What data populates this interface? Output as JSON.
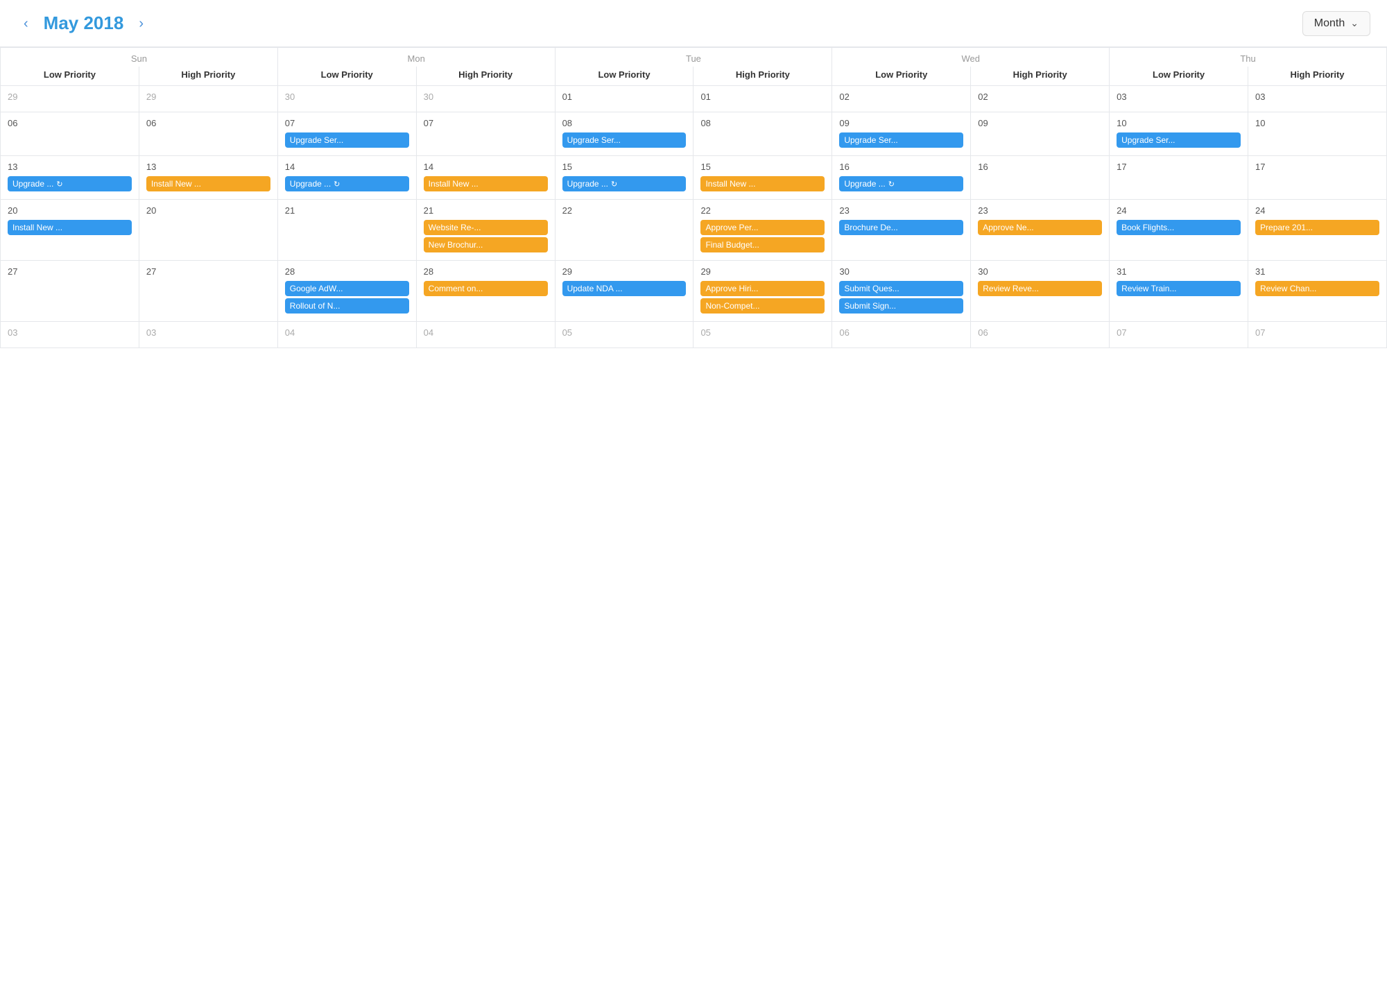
{
  "header": {
    "title": "May 2018",
    "prev_label": "‹",
    "next_label": "›",
    "view_label": "Month",
    "chevron": "⌄"
  },
  "days": [
    {
      "name": "Sun",
      "cols": [
        "Low Priority",
        "High Priority"
      ]
    },
    {
      "name": "Mon",
      "cols": [
        "Low Priority",
        "High Priority"
      ]
    },
    {
      "name": "Tue",
      "cols": [
        "Low Priority",
        "High Priority"
      ]
    },
    {
      "name": "Wed",
      "cols": [
        "Low Priority",
        "High Priority"
      ]
    },
    {
      "name": "Thu",
      "cols": [
        "Low Priority",
        "High Priority"
      ]
    }
  ],
  "weeks": [
    {
      "cells": [
        {
          "date": "29",
          "month": "prev",
          "events": []
        },
        {
          "date": "29",
          "month": "prev",
          "events": []
        },
        {
          "date": "30",
          "month": "prev",
          "events": []
        },
        {
          "date": "30",
          "month": "prev",
          "events": []
        },
        {
          "date": "01",
          "month": "curr",
          "events": []
        },
        {
          "date": "01",
          "month": "curr",
          "events": []
        },
        {
          "date": "02",
          "month": "curr",
          "events": []
        },
        {
          "date": "02",
          "month": "curr",
          "events": []
        },
        {
          "date": "03",
          "month": "curr",
          "events": []
        },
        {
          "date": "03",
          "month": "curr",
          "events": []
        }
      ]
    },
    {
      "cells": [
        {
          "date": "06",
          "month": "curr",
          "events": []
        },
        {
          "date": "06",
          "month": "curr",
          "events": []
        },
        {
          "date": "07",
          "month": "curr",
          "events": [
            {
              "label": "Upgrade Ser...",
              "type": "blue"
            }
          ]
        },
        {
          "date": "07",
          "month": "curr",
          "events": []
        },
        {
          "date": "08",
          "month": "curr",
          "events": [
            {
              "label": "Upgrade Ser...",
              "type": "blue"
            }
          ]
        },
        {
          "date": "08",
          "month": "curr",
          "events": []
        },
        {
          "date": "09",
          "month": "curr",
          "events": [
            {
              "label": "Upgrade Ser...",
              "type": "blue"
            }
          ]
        },
        {
          "date": "09",
          "month": "curr",
          "events": []
        },
        {
          "date": "10",
          "month": "curr",
          "events": [
            {
              "label": "Upgrade Ser...",
              "type": "blue"
            }
          ]
        },
        {
          "date": "10",
          "month": "curr",
          "events": []
        }
      ]
    },
    {
      "cells": [
        {
          "date": "13",
          "month": "curr",
          "events": [
            {
              "label": "Upgrade ...",
              "type": "blue",
              "icon": "↻"
            }
          ]
        },
        {
          "date": "13",
          "month": "curr",
          "events": [
            {
              "label": "Install New ...",
              "type": "orange"
            }
          ]
        },
        {
          "date": "14",
          "month": "curr",
          "events": [
            {
              "label": "Upgrade ...",
              "type": "blue",
              "icon": "↻"
            }
          ]
        },
        {
          "date": "14",
          "month": "curr",
          "events": [
            {
              "label": "Install New ...",
              "type": "orange"
            }
          ]
        },
        {
          "date": "15",
          "month": "curr",
          "events": [
            {
              "label": "Upgrade ...",
              "type": "blue",
              "icon": "↻"
            }
          ]
        },
        {
          "date": "15",
          "month": "curr",
          "events": [
            {
              "label": "Install New ...",
              "type": "orange"
            }
          ]
        },
        {
          "date": "16",
          "month": "curr",
          "events": [
            {
              "label": "Upgrade ...",
              "type": "blue",
              "icon": "↻"
            }
          ]
        },
        {
          "date": "16",
          "month": "curr",
          "events": []
        },
        {
          "date": "17",
          "month": "curr",
          "events": []
        },
        {
          "date": "17",
          "month": "curr",
          "events": []
        }
      ]
    },
    {
      "cells": [
        {
          "date": "20",
          "month": "curr",
          "events": [
            {
              "label": "Install New ...",
              "type": "blue"
            }
          ]
        },
        {
          "date": "20",
          "month": "curr",
          "events": []
        },
        {
          "date": "21",
          "month": "curr",
          "events": []
        },
        {
          "date": "21",
          "month": "curr",
          "events": [
            {
              "label": "Website Re-...",
              "type": "orange"
            },
            {
              "label": "New Brochur...",
              "type": "orange"
            }
          ]
        },
        {
          "date": "22",
          "month": "curr",
          "events": []
        },
        {
          "date": "22",
          "month": "curr",
          "events": [
            {
              "label": "Approve Per...",
              "type": "orange"
            },
            {
              "label": "Final Budget...",
              "type": "orange"
            }
          ]
        },
        {
          "date": "23",
          "month": "curr",
          "events": [
            {
              "label": "Brochure De...",
              "type": "blue"
            }
          ]
        },
        {
          "date": "23",
          "month": "curr",
          "events": [
            {
              "label": "Approve Ne...",
              "type": "orange"
            }
          ]
        },
        {
          "date": "24",
          "month": "curr",
          "events": [
            {
              "label": "Book Flights...",
              "type": "blue"
            }
          ]
        },
        {
          "date": "24",
          "month": "curr",
          "events": [
            {
              "label": "Prepare 201...",
              "type": "orange"
            }
          ]
        }
      ]
    },
    {
      "cells": [
        {
          "date": "27",
          "month": "curr",
          "events": []
        },
        {
          "date": "27",
          "month": "curr",
          "events": []
        },
        {
          "date": "28",
          "month": "curr",
          "events": [
            {
              "label": "Google AdW...",
              "type": "blue"
            },
            {
              "label": "Rollout of N...",
              "type": "blue"
            }
          ]
        },
        {
          "date": "28",
          "month": "curr",
          "events": [
            {
              "label": "Comment on...",
              "type": "orange"
            }
          ]
        },
        {
          "date": "29",
          "month": "curr",
          "events": [
            {
              "label": "Update NDA ...",
              "type": "blue"
            }
          ]
        },
        {
          "date": "29",
          "month": "curr",
          "events": [
            {
              "label": "Approve Hiri...",
              "type": "orange"
            },
            {
              "label": "Non-Compet...",
              "type": "orange"
            }
          ]
        },
        {
          "date": "30",
          "month": "curr",
          "events": [
            {
              "label": "Submit Ques...",
              "type": "blue"
            },
            {
              "label": "Submit Sign...",
              "type": "blue"
            }
          ]
        },
        {
          "date": "30",
          "month": "curr",
          "events": [
            {
              "label": "Review Reve...",
              "type": "orange"
            }
          ]
        },
        {
          "date": "31",
          "month": "curr",
          "events": [
            {
              "label": "Review Train...",
              "type": "blue"
            }
          ]
        },
        {
          "date": "31",
          "month": "curr",
          "events": [
            {
              "label": "Review Chan...",
              "type": "orange"
            }
          ]
        }
      ]
    },
    {
      "cells": [
        {
          "date": "03",
          "month": "next",
          "events": []
        },
        {
          "date": "03",
          "month": "next",
          "events": []
        },
        {
          "date": "04",
          "month": "next",
          "events": []
        },
        {
          "date": "04",
          "month": "next",
          "events": []
        },
        {
          "date": "05",
          "month": "next",
          "events": []
        },
        {
          "date": "05",
          "month": "next",
          "events": []
        },
        {
          "date": "06",
          "month": "next",
          "events": []
        },
        {
          "date": "06",
          "month": "next",
          "events": []
        },
        {
          "date": "07",
          "month": "next",
          "events": []
        },
        {
          "date": "07",
          "month": "next",
          "events": []
        }
      ]
    }
  ]
}
